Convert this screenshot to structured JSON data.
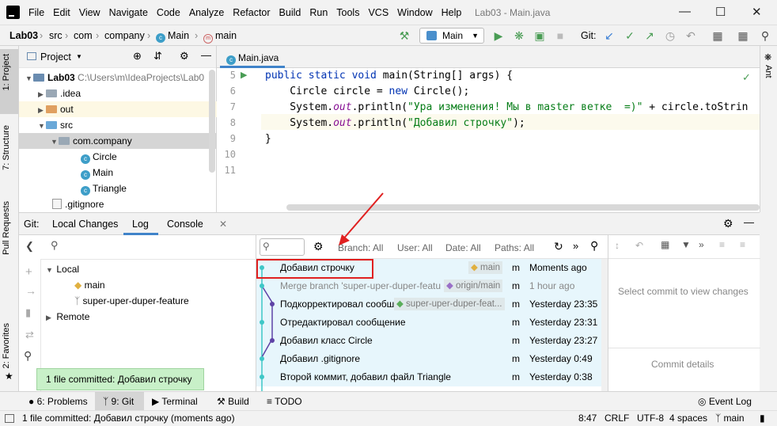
{
  "menu": [
    "File",
    "Edit",
    "View",
    "Navigate",
    "Code",
    "Analyze",
    "Refactor",
    "Build",
    "Run",
    "Tools",
    "VCS",
    "Window",
    "Help"
  ],
  "window_title": "Lab03 - Main.java",
  "breadcrumbs": {
    "project": "Lab03",
    "src": "src",
    "com": "com",
    "company": "company",
    "main_class": "Main",
    "main_method": "main"
  },
  "run_config": "Main",
  "git_label": "Git:",
  "left_tabs": {
    "project": "1: Project",
    "structure": "7: Structure",
    "pull": "Pull Requests",
    "favorites": "2: Favorites"
  },
  "right_tabs": {
    "ant": "Ant"
  },
  "project_panel": {
    "title": "Project",
    "tree": [
      {
        "label": "Lab03",
        "path": "C:\\Users\\m\\IdeaProjects\\Lab0"
      },
      {
        "label": ".idea"
      },
      {
        "label": "out"
      },
      {
        "label": "src"
      },
      {
        "label": "com.company"
      },
      {
        "label": "Circle"
      },
      {
        "label": "Main"
      },
      {
        "label": "Triangle"
      },
      {
        "label": ".gitignore"
      }
    ]
  },
  "editor": {
    "tab": "Main.java",
    "line_numbers": [
      "5",
      "6",
      "7",
      "8",
      "9",
      "10",
      "11"
    ],
    "lines": {
      "l5a": "public static void ",
      "l5b": "main(String[] args) {",
      "l6a": "    Circle circle = ",
      "l6b": "new ",
      "l6c": "Circle();",
      "l7a": "    System.",
      "l7b": "out",
      "l7c": ".println(",
      "l7d": "\"Ура изменения! Мы в master ветке  =)\"",
      "l7e": " + circle.toStrin",
      "l8a": "    System.",
      "l8b": "out",
      "l8c": ".println(",
      "l8d": "\"Добавил строчку\"",
      "l8e": ");",
      "l9": "}"
    }
  },
  "tool_window": {
    "git_label": "Git:",
    "tabs": [
      "Local Changes",
      "Log",
      "Console"
    ],
    "branches": {
      "local": "Local",
      "main": "main",
      "feature": "super-uper-duper-feature",
      "remote": "Remote"
    },
    "filters": {
      "branch": "Branch: All",
      "user": "User: All",
      "date": "Date: All",
      "paths": "Paths: All"
    },
    "commits": [
      {
        "msg": "Добавил строчку",
        "tag": "main",
        "author": "m",
        "date": "Moments ago"
      },
      {
        "msg": "Merge branch 'super-uper-duper-featu",
        "tag": "origin/main",
        "author": "m",
        "date": "1 hour ago"
      },
      {
        "msg": "Подкорректировал сообш",
        "tag": "super-uper-duper-feat...",
        "author": "m",
        "date": "Yesterday 23:35"
      },
      {
        "msg": "Отредактировал сообщение",
        "tag": "",
        "author": "m",
        "date": "Yesterday 23:31"
      },
      {
        "msg": "Добавил класс Circle",
        "tag": "",
        "author": "m",
        "date": "Yesterday 23:27"
      },
      {
        "msg": "Добавил .gitignore",
        "tag": "",
        "author": "m",
        "date": "Yesterday 0:49"
      },
      {
        "msg": "Второй коммит, добавил файл Triangle",
        "tag": "",
        "author": "m",
        "date": "Yesterday 0:38"
      }
    ],
    "details": {
      "select": "Select commit to view changes",
      "commit_details": "Commit details"
    }
  },
  "tooltip": "1 file committed: Добавил строчку",
  "bottom_tabs": {
    "problems": "6: Problems",
    "git": "9: Git",
    "terminal": "Terminal",
    "build": "Build",
    "todo": "TODO",
    "event_log": "Event Log"
  },
  "status": {
    "message": "1 file committed: Добавил строчку (moments ago)",
    "pos": "8:47",
    "eol": "CRLF",
    "enc": "UTF-8",
    "indent": "4 spaces",
    "branch": "main"
  },
  "colors": {
    "accent": "#4083c9",
    "commit_bg": "#e7f6fc",
    "graph": "#5e42a6",
    "highlight": "#e02020",
    "green": "#499c54"
  }
}
